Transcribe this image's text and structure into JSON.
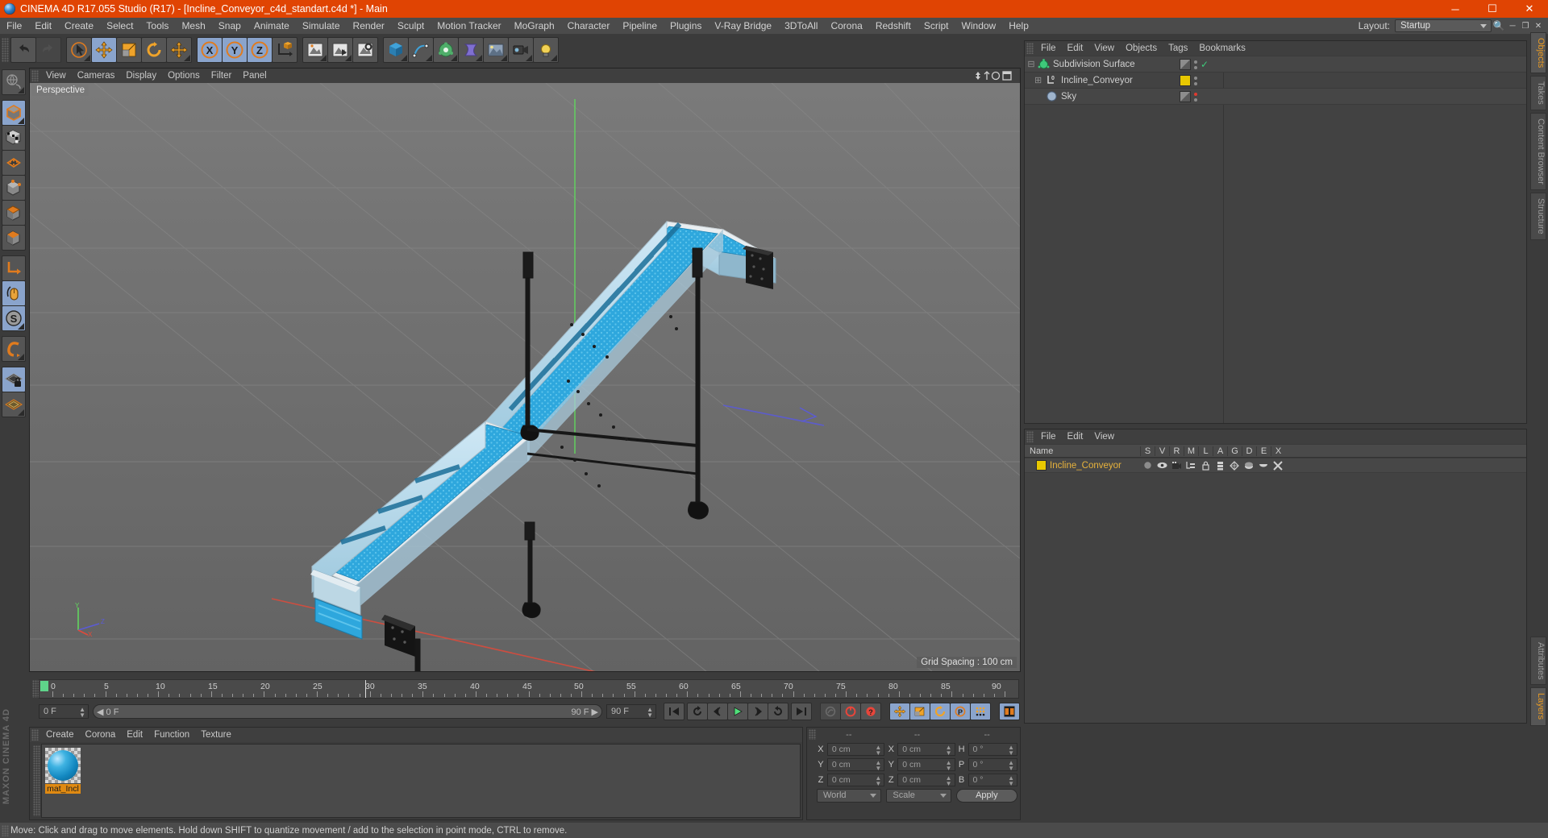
{
  "window": {
    "title": "CINEMA 4D R17.055 Studio (R17) - [Incline_Conveyor_c4d_standart.c4d *] - Main",
    "logo": "cinema4d-logo",
    "minimize": "─",
    "maximize": "☐",
    "close": "✕"
  },
  "menu": {
    "items": [
      "File",
      "Edit",
      "Create",
      "Select",
      "Tools",
      "Mesh",
      "Snap",
      "Animate",
      "Simulate",
      "Render",
      "Sculpt",
      "Motion Tracker",
      "MoGraph",
      "Character",
      "Pipeline",
      "Plugins",
      "V-Ray Bridge",
      "3DToAll",
      "Corona",
      "Redshift",
      "Script",
      "Window",
      "Help"
    ],
    "layout_label": "Layout:",
    "layout_value": "Startup",
    "search_icon": "search-icon",
    "win_min": "─",
    "win_max": "❐",
    "win_close": "✕"
  },
  "toolbar": {
    "undo": "undo-icon",
    "redo": "redo-icon",
    "live_select": "live-select-icon",
    "move": "move-icon",
    "scale": "scale-icon",
    "rotate": "rotate-icon",
    "move_dup": "move-axis-icon",
    "axis_x": "X",
    "axis_y": "Y",
    "axis_z": "Z",
    "world_coord": "world-coordinate-icon",
    "render_view": "render-view-icon",
    "render_region": "render-to-picture-viewer-icon",
    "render_settings": "render-settings-icon",
    "cube": "cube-primitive-icon",
    "spline": "spline-pen-icon",
    "generator": "generator-icon",
    "deformer": "deformer-icon",
    "environment": "environment-icon",
    "camera": "camera-icon",
    "light": "light-icon"
  },
  "left_tools": {
    "items": [
      {
        "name": "undo-view-icon",
        "active": false
      },
      {
        "name": "model-mode-icon",
        "active": true
      },
      {
        "name": "texture-mode-icon",
        "active": false
      },
      {
        "name": "points-mode-icon",
        "active": false
      },
      {
        "name": "edges-mode-icon",
        "active": false
      },
      {
        "name": "polygons-mode-icon",
        "active": false
      },
      {
        "name": "object-axis-mode-icon",
        "active": false
      },
      {
        "name": "axis-modify-icon",
        "active": false
      },
      {
        "name": "enable-snap-icon",
        "active": true
      },
      {
        "name": "snap-settings-icon",
        "active": true
      },
      {
        "name": "magnet-icon",
        "active": false
      },
      {
        "name": "workplane-lock-icon",
        "active": true
      },
      {
        "name": "workplane-icon",
        "active": false
      }
    ],
    "brand": "MAXON CINEMA 4D"
  },
  "viewport": {
    "menu": [
      "View",
      "Cameras",
      "Display",
      "Options",
      "Filter",
      "Panel"
    ],
    "label": "Perspective",
    "grid_spacing": "Grid Spacing : 100 cm",
    "axis_labels": {
      "x": "X",
      "y": "Y",
      "z": "Z"
    },
    "scene_description": "Blue incline belt conveyor 3D model on grey grid floor"
  },
  "timeline": {
    "ticks": [
      "0",
      "5",
      "10",
      "15",
      "20",
      "25",
      "30",
      "35",
      "40",
      "45",
      "50",
      "55",
      "60",
      "65",
      "70",
      "75",
      "80",
      "85",
      "90"
    ],
    "current_frame_field": "0 F",
    "current_frame_right": "0 F",
    "range_start": "0 F",
    "range_end": "90 F",
    "preview_end": "90 F",
    "document_end": "90 F",
    "playback": [
      {
        "name": "go-to-start-button",
        "glyph": "⏮"
      },
      {
        "name": "previous-keyframe-button",
        "glyph": "↶"
      },
      {
        "name": "previous-frame-button",
        "glyph": "◁"
      },
      {
        "name": "play-forwards-button",
        "glyph": "▶"
      },
      {
        "name": "next-frame-button",
        "glyph": "▷"
      },
      {
        "name": "next-keyframe-button",
        "glyph": "↷"
      },
      {
        "name": "go-to-end-button",
        "glyph": "⏭"
      }
    ],
    "record_group": [
      {
        "name": "record-active-objects-button"
      },
      {
        "name": "autokeying-button"
      },
      {
        "name": "keyframe-selection-button"
      }
    ],
    "key_toggles": [
      {
        "name": "position-key-button",
        "active": true
      },
      {
        "name": "scale-key-button",
        "active": true
      },
      {
        "name": "rotation-key-button",
        "active": true
      },
      {
        "name": "parameter-key-button",
        "active": true
      },
      {
        "name": "point-level-animation-button",
        "active": true
      }
    ],
    "timeline_button": "timeline-window-button"
  },
  "materials": {
    "menu": [
      "Create",
      "Corona",
      "Edit",
      "Function",
      "Texture"
    ],
    "items": [
      {
        "name": "mat_Incl",
        "selected": true
      }
    ]
  },
  "coordinates": {
    "header": [
      "--",
      "--",
      "--"
    ],
    "rows": [
      {
        "label1": "X",
        "value1": "0 cm",
        "label2": "X",
        "value2": "0 cm",
        "label3": "H",
        "value3": "0 °"
      },
      {
        "label1": "Y",
        "value1": "0 cm",
        "label2": "Y",
        "value2": "0 cm",
        "label3": "P",
        "value3": "0 °"
      },
      {
        "label1": "Z",
        "value1": "0 cm",
        "label2": "Z",
        "value2": "0 cm",
        "label3": "B",
        "value3": "0 °"
      }
    ],
    "system": "World",
    "mode": "Scale",
    "apply": "Apply"
  },
  "object_manager": {
    "menu": [
      "File",
      "Edit",
      "View",
      "Objects",
      "Tags",
      "Bookmarks"
    ],
    "rows": [
      {
        "name": "Subdivision Surface",
        "icon": "subdivision-surface-icon",
        "indent": 0,
        "expander": "⊟",
        "selected": false,
        "tag": "checker",
        "dot": "grey",
        "check": true
      },
      {
        "name": "Incline_Conveyor",
        "icon": "null-object-icon",
        "indent": 1,
        "expander": "⊞",
        "selected": false,
        "tag": "yellow",
        "dot": "grey",
        "check": false
      },
      {
        "name": "Sky",
        "icon": "sky-object-icon",
        "indent": 1,
        "expander": "",
        "selected": false,
        "tag": "checker",
        "dot": "red",
        "check": false
      }
    ]
  },
  "layer_manager": {
    "menu": [
      "File",
      "Edit",
      "View"
    ],
    "columns": [
      "Name",
      "S",
      "V",
      "R",
      "M",
      "L",
      "A",
      "G",
      "D",
      "E",
      "X"
    ],
    "rows": [
      {
        "name": "Incline_Conveyor",
        "color": "#e8c800"
      }
    ]
  },
  "right_tabs": {
    "top": [
      {
        "label": "Objects",
        "active": true
      },
      {
        "label": "Takes",
        "active": false
      },
      {
        "label": "Content Browser",
        "active": false
      },
      {
        "label": "Structure",
        "active": false
      }
    ],
    "bottom": [
      {
        "label": "Attributes",
        "active": false
      },
      {
        "label": "Layers",
        "active": true
      }
    ]
  },
  "status": {
    "message": "Move: Click and drag to move elements. Hold down SHIFT to quantize movement / add to the selection in point mode, CTRL to remove."
  },
  "colors": {
    "title_bar": "#e04403",
    "menu_bar": "#4b4b4b",
    "panel": "#3b3b3b",
    "button": "#555555",
    "button_active": "#8aa4cc",
    "accent_orange": "#e89a24",
    "selected_text": "#e8b33c",
    "belt_blue": "#2ca7dd",
    "viewport_bg": "#6e6e6e"
  }
}
